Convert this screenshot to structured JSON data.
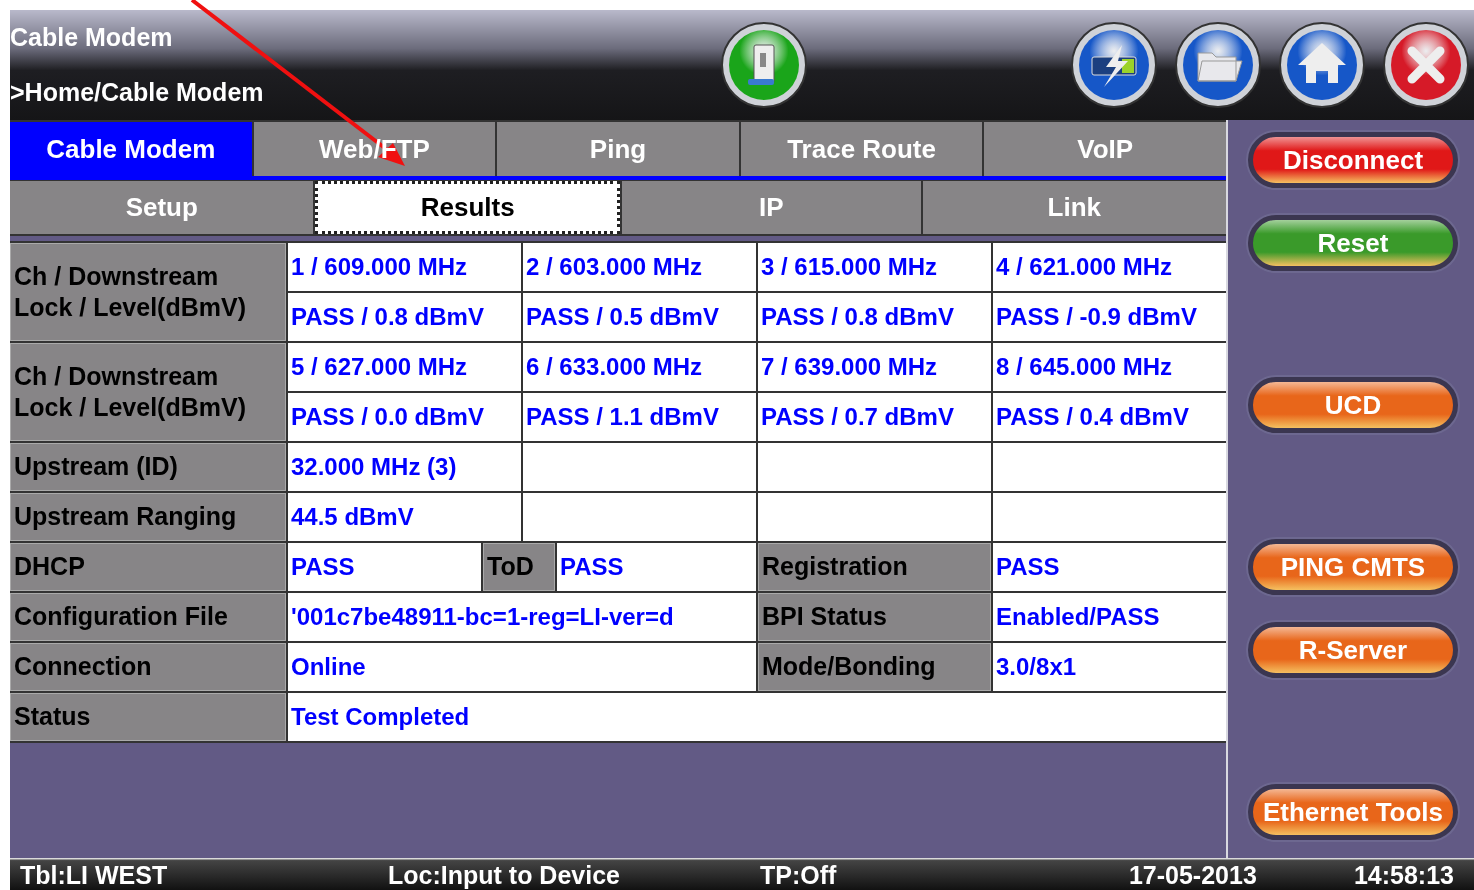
{
  "header": {
    "title": "Cable Modem",
    "breadcrumb": ">Home/Cable Modem"
  },
  "tabs": [
    {
      "label": "Cable Modem",
      "selected": true
    },
    {
      "label": "Web/FTP",
      "selected": false
    },
    {
      "label": "Ping",
      "selected": false
    },
    {
      "label": "Trace Route",
      "selected": false
    },
    {
      "label": "VoIP",
      "selected": false
    }
  ],
  "subtabs": [
    {
      "label": "Setup",
      "selected": false
    },
    {
      "label": "Results",
      "selected": true
    },
    {
      "label": "IP",
      "selected": false
    },
    {
      "label": "Link",
      "selected": false
    }
  ],
  "table": {
    "rows": [
      {
        "kind": "channels",
        "label": "Ch / Downstream\nLock / Level(dBmV)",
        "frequencies": [
          "1 / 609.000 MHz",
          "2 / 603.000 MHz",
          "3 / 615.000 MHz",
          "4 / 621.000 MHz"
        ],
        "levels": [
          "PASS / 0.8 dBmV",
          "PASS / 0.5 dBmV",
          "PASS / 0.8 dBmV",
          "PASS / -0.9 dBmV"
        ]
      },
      {
        "kind": "channels",
        "label": "Ch / Downstream\nLock / Level(dBmV)",
        "frequencies": [
          "5 / 627.000 MHz",
          "6 / 633.000 MHz",
          "7 / 639.000 MHz",
          "8 / 645.000 MHz"
        ],
        "levels": [
          "PASS / 0.0 dBmV",
          "PASS / 1.1 dBmV",
          "PASS / 0.7 dBmV",
          "PASS / 0.4 dBmV"
        ]
      },
      {
        "kind": "single",
        "label": "Upstream (ID)",
        "value": "32.000 MHz (3)"
      },
      {
        "kind": "single",
        "label": "Upstream Ranging",
        "value": "44.5 dBmV"
      },
      {
        "kind": "split",
        "label": "DHCP",
        "value": "PASS",
        "sub_label": "ToD",
        "sub_value": "PASS",
        "right_label": "Registration",
        "right_value": "PASS"
      },
      {
        "kind": "pair",
        "label": "Configuration File",
        "value": "'001c7be48911-bc=1-reg=LI-ver=d",
        "right_label": "BPI Status",
        "right_value": "Enabled/PASS"
      },
      {
        "kind": "pair",
        "label": "Connection",
        "value": "Online",
        "right_label": "Mode/Bonding",
        "right_value": "3.0/8x1"
      },
      {
        "kind": "full",
        "label": "Status",
        "value": "Test Completed"
      }
    ]
  },
  "side_groups": [
    {
      "buttons": [
        {
          "label": "Disconnect",
          "color": "#e01818"
        },
        {
          "label": "Reset",
          "color": "#3a9a2a"
        }
      ]
    },
    {
      "buttons": [
        {
          "label": "UCD",
          "color": "#e8661a"
        }
      ]
    },
    {
      "buttons": [
        {
          "label": "PING CMTS",
          "color": "#e8661a"
        },
        {
          "label": "R-Server",
          "color": "#e8661a"
        }
      ]
    },
    {
      "buttons": [
        {
          "label": "Ethernet Tools",
          "color": "#e8661a"
        }
      ]
    }
  ],
  "status_bar": {
    "table": "Tbl:LI WEST",
    "location": "Loc:Input to Device",
    "tp": "TP:Off",
    "date": "17-05-2013",
    "time": "14:58:13"
  }
}
